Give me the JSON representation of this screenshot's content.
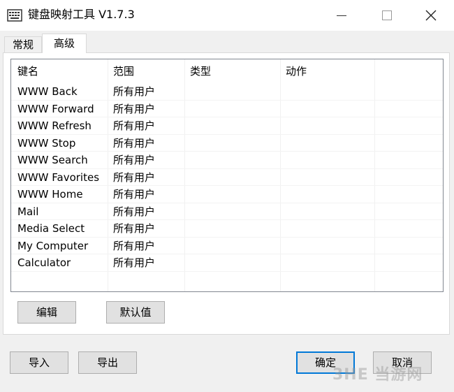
{
  "window": {
    "title": "键盘映射工具 V1.7.3"
  },
  "tabs": [
    {
      "label": "常规",
      "active": false
    },
    {
      "label": "高级",
      "active": true
    }
  ],
  "table": {
    "columns": [
      "键名",
      "范围",
      "类型",
      "动作"
    ],
    "rows": [
      {
        "key": "WWW Back",
        "scope": "所有用户",
        "type": "",
        "action": ""
      },
      {
        "key": "WWW Forward",
        "scope": "所有用户",
        "type": "",
        "action": ""
      },
      {
        "key": "WWW Refresh",
        "scope": "所有用户",
        "type": "",
        "action": ""
      },
      {
        "key": "WWW Stop",
        "scope": "所有用户",
        "type": "",
        "action": ""
      },
      {
        "key": "WWW Search",
        "scope": "所有用户",
        "type": "",
        "action": ""
      },
      {
        "key": "WWW Favorites",
        "scope": "所有用户",
        "type": "",
        "action": ""
      },
      {
        "key": "WWW Home",
        "scope": "所有用户",
        "type": "",
        "action": ""
      },
      {
        "key": "Mail",
        "scope": "所有用户",
        "type": "",
        "action": ""
      },
      {
        "key": "Media Select",
        "scope": "所有用户",
        "type": "",
        "action": ""
      },
      {
        "key": "My Computer",
        "scope": "所有用户",
        "type": "",
        "action": ""
      },
      {
        "key": "Calculator",
        "scope": "所有用户",
        "type": "",
        "action": ""
      }
    ]
  },
  "panel_buttons": {
    "edit": "编辑",
    "default_value": "默认值"
  },
  "footer_buttons": {
    "import": "导入",
    "export": "导出",
    "ok": "确定",
    "cancel": "取消"
  },
  "watermark": "3HE 当游网",
  "colors": {
    "window_bg": "#f0f0f0",
    "panel_bg": "#ffffff",
    "button_bg": "#e1e1e1",
    "button_border": "#adadad",
    "default_button_border": "#0078d7"
  },
  "icons": {
    "app": "keyboard-icon",
    "close": "close-icon"
  }
}
